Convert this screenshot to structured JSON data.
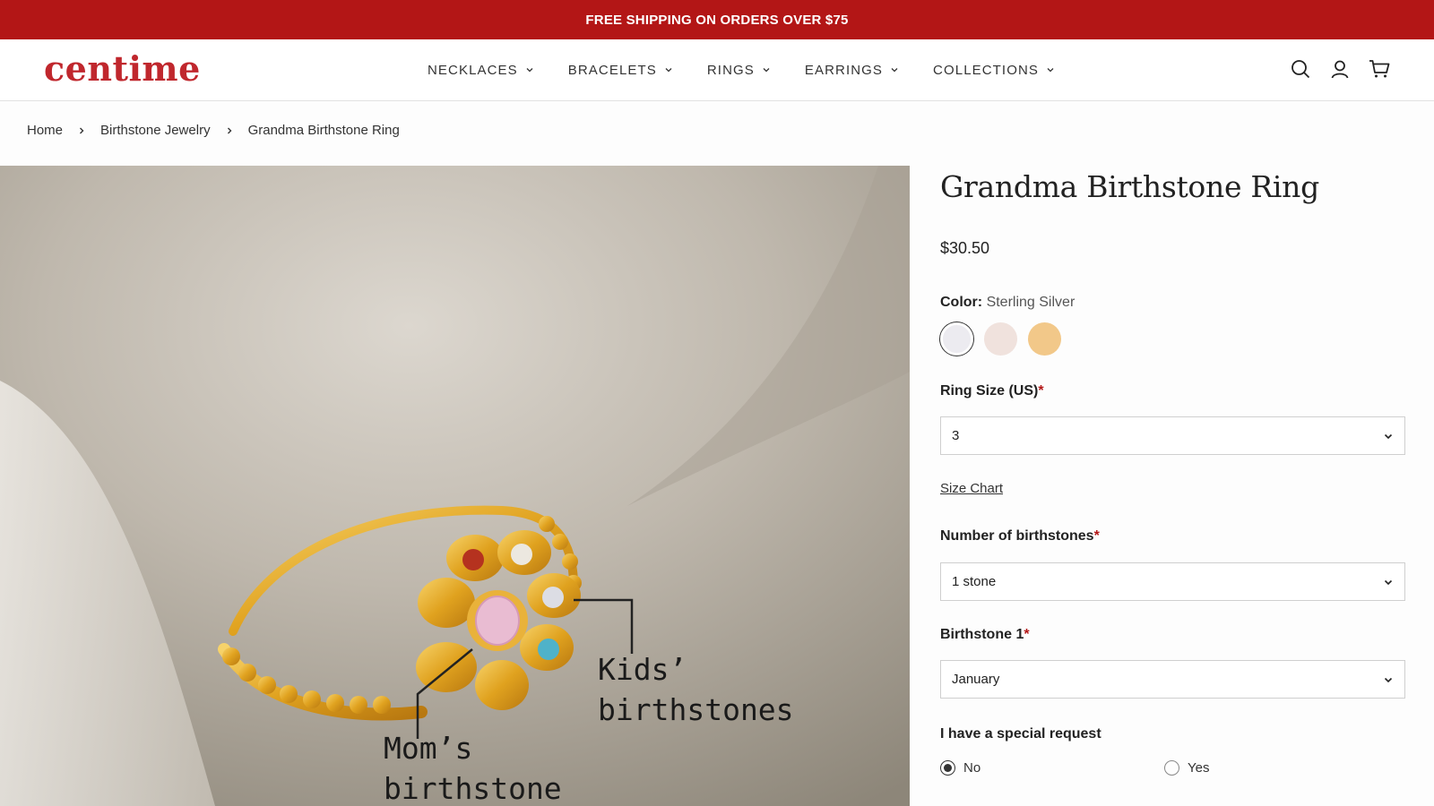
{
  "announcement": "FREE SHIPPING ON ORDERS OVER $75",
  "brand": {
    "logo_text": "centime",
    "color": "#c0272d"
  },
  "nav": [
    {
      "label": "NECKLACES"
    },
    {
      "label": "BRACELETS"
    },
    {
      "label": "RINGS"
    },
    {
      "label": "EARRINGS"
    },
    {
      "label": "COLLECTIONS"
    }
  ],
  "header_icons": [
    "search-icon",
    "account-icon",
    "cart-icon"
  ],
  "breadcrumb": [
    "Home",
    "Birthstone Jewelry",
    "Grandma Birthstone Ring"
  ],
  "product": {
    "title": "Grandma Birthstone Ring",
    "price": "$30.50",
    "color_label": "Color:",
    "color_value": "Sterling Silver",
    "swatches": [
      {
        "name": "Sterling Silver",
        "color": "#ecebf0",
        "selected": true
      },
      {
        "name": "Rose",
        "color": "#f0e2dd",
        "selected": false
      },
      {
        "name": "Gold",
        "color": "#f2c889",
        "selected": false
      }
    ],
    "ring_size_label": "Ring Size (US)",
    "ring_size_value": "3",
    "size_chart_link": "Size Chart",
    "stones_label": "Number of birthstones",
    "stones_value": "1 stone",
    "birthstone1_label": "Birthstone 1",
    "birthstone1_value": "January",
    "special_request_label": "I have a special request",
    "special_request_options": [
      "No",
      "Yes"
    ],
    "special_request_selected": "No",
    "required_mark": "*"
  },
  "image_annotations": {
    "kids": "Kids’ birthstones",
    "mom": "Mom’s birthstone"
  },
  "colors": {
    "accent_red": "#b31616"
  }
}
